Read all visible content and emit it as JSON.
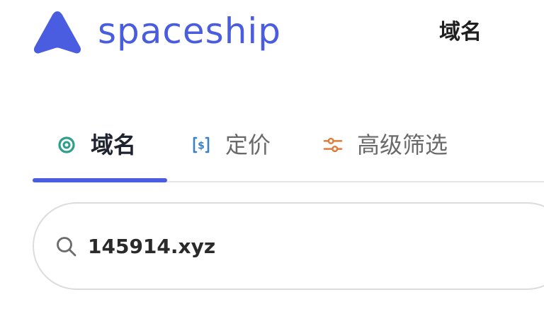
{
  "header": {
    "brand_name": "spaceship",
    "nav_domain_label": "域名"
  },
  "tabs": [
    {
      "label": "域名",
      "icon": "target-icon",
      "active": true
    },
    {
      "label": "定价",
      "icon": "price-tag-icon",
      "active": false
    },
    {
      "label": "高级筛选",
      "icon": "filter-sliders-icon",
      "active": false
    }
  ],
  "search": {
    "value": "145914.xyz",
    "icon": "search-icon"
  },
  "colors": {
    "brand": "#4a5de0",
    "tab_domain_icon": "#2e9e8f",
    "tab_price_icon": "#3b82c4",
    "tab_filter_icon": "#e07b39"
  }
}
